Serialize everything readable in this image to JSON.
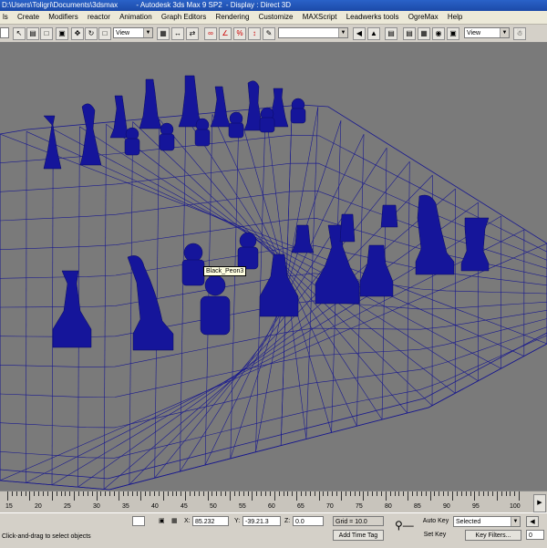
{
  "title": {
    "path": "D:\\Users\\Toligri\\Documents\\3dsmax",
    "app": "- Autodesk 3ds Max 9 SP2",
    "display": "- Display : Direct 3D"
  },
  "menu": [
    "ls",
    "Create",
    "Modifiers",
    "reactor",
    "Animation",
    "Graph Editors",
    "Rendering",
    "Customize",
    "MAXScript",
    "Leadwerks tools",
    "OgreMax",
    "Help"
  ],
  "toolbar": {
    "reference_coord": "View",
    "named_selection": "",
    "view_dropdown": "View"
  },
  "viewport": {
    "tooltip": "Black_Peon3",
    "colors": {
      "background": "#7a7a7a",
      "wire": "#1a1a8e",
      "pieces": "#15159a"
    }
  },
  "timeline": {
    "ticks": [
      "15",
      "20",
      "25",
      "30",
      "35",
      "40",
      "45",
      "50",
      "55",
      "60",
      "65",
      "70",
      "75",
      "80",
      "85",
      "90",
      "95",
      "100"
    ]
  },
  "status": {
    "prompt": "Click-and-drag to select objects",
    "x_label": "X:",
    "x_value": "85.232",
    "y_label": "Y:",
    "y_value": "-39.21.3",
    "z_label": "Z:",
    "z_value": "0.0",
    "grid": "Grid = 10.0",
    "add_time_tag": "Add Time Tag",
    "auto_key": "Auto Key",
    "selected": "Selected",
    "set_key": "Set Key",
    "key_filters": "Key Filters...",
    "frame": "0"
  }
}
